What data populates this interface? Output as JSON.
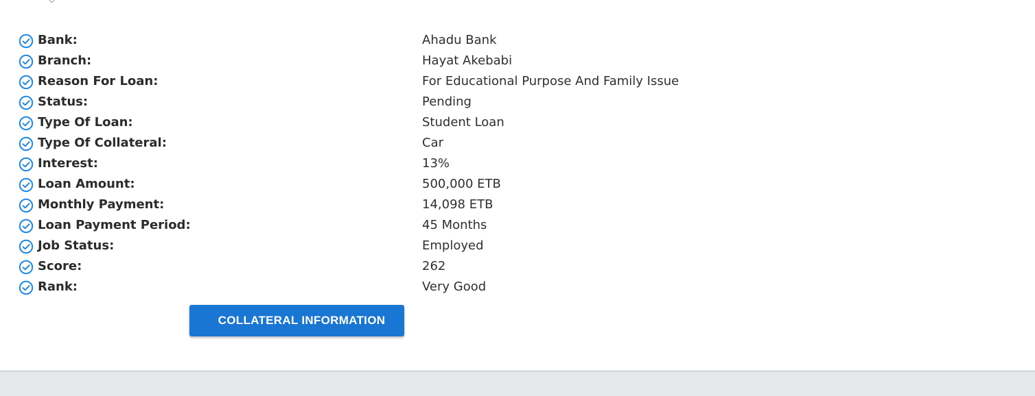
{
  "colors": {
    "accent": "#1976d2",
    "check_icon": "#1e88e5",
    "label_text": "#2b2b2b",
    "footer_bg": "#e4e8eb"
  },
  "details": [
    {
      "label": "Bank:",
      "value": "Ahadu Bank",
      "icon": "check-circle-icon"
    },
    {
      "label": "Branch:",
      "value": "Hayat Akebabi",
      "icon": "check-circle-icon"
    },
    {
      "label": "Reason For Loan:",
      "value": "For Educational Purpose And Family Issue",
      "icon": "check-circle-icon"
    },
    {
      "label": "Status:",
      "value": "Pending",
      "icon": "check-circle-icon"
    },
    {
      "label": "Type Of Loan:",
      "value": "Student Loan",
      "icon": "check-circle-icon"
    },
    {
      "label": "Type Of Collateral:",
      "value": "Car",
      "icon": "check-circle-icon"
    },
    {
      "label": "Interest:",
      "value": "13%",
      "icon": "check-circle-icon"
    },
    {
      "label": "Loan Amount:",
      "value": "500,000 ETB",
      "icon": "check-circle-icon"
    },
    {
      "label": "Monthly Payment:",
      "value": "14,098 ETB",
      "icon": "check-circle-icon"
    },
    {
      "label": "Loan Payment Period:",
      "value": "45 Months",
      "icon": "check-circle-icon"
    },
    {
      "label": "Job Status:",
      "value": "Employed",
      "icon": "check-circle-icon"
    },
    {
      "label": "Score:",
      "value": "262",
      "icon": "check-circle-icon"
    },
    {
      "label": "Rank:",
      "value": "Very Good",
      "icon": "check-circle-icon"
    }
  ],
  "actions": {
    "collateral_button_label": "COLLATERAL INFORMATION"
  }
}
